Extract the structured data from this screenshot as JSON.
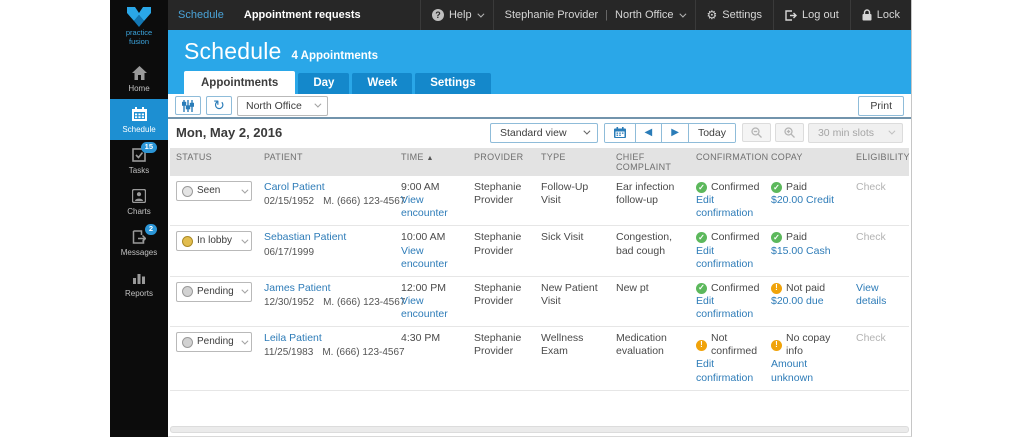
{
  "colors": {
    "accent_blue": "#2aa7e8",
    "tab_blue": "#1488cb",
    "sidebar_active_blue": "#1d8fd2",
    "link_blue": "#2e7cb8",
    "confirmed_green": "#5cb85c",
    "warning_orange": "#f0a30a",
    "topbar_bg": "#272727"
  },
  "sidebar": {
    "logo_line1": "practice",
    "logo_line2": "fusion",
    "items": [
      {
        "label": "Home",
        "icon": "home-icon",
        "active": false,
        "badge": ""
      },
      {
        "label": "Schedule",
        "icon": "calendar-icon",
        "active": true,
        "badge": ""
      },
      {
        "label": "Tasks",
        "icon": "tasks-icon",
        "active": false,
        "badge": "15"
      },
      {
        "label": "Charts",
        "icon": "person-icon",
        "active": false,
        "badge": ""
      },
      {
        "label": "Messages",
        "icon": "message-icon",
        "active": false,
        "badge": "2"
      },
      {
        "label": "Reports",
        "icon": "bar-chart-icon",
        "active": false,
        "badge": ""
      }
    ]
  },
  "topbar": {
    "nav": [
      {
        "label": "Schedule",
        "active": true
      },
      {
        "label": "Appointment requests",
        "active": false
      }
    ],
    "help": "Help",
    "user": "Stephanie Provider",
    "office": "North Office",
    "settings": "Settings",
    "logout": "Log out",
    "lock": "Lock"
  },
  "header": {
    "title": "Schedule",
    "subtitle": "4 Appointments",
    "tabs": [
      {
        "label": "Appointments",
        "active": true
      },
      {
        "label": "Day",
        "active": false
      },
      {
        "label": "Week",
        "active": false
      },
      {
        "label": "Settings",
        "active": false
      }
    ]
  },
  "toolbar": {
    "office_dropdown": "North Office",
    "print_label": "Print"
  },
  "datebar": {
    "date": "Mon, May 2, 2016",
    "view_dropdown": "Standard view",
    "today_label": "Today",
    "slots_dropdown": "30 min slots",
    "prev_glyph": "◀",
    "next_glyph": "▶"
  },
  "table": {
    "columns": [
      "STATUS",
      "PATIENT",
      "TIME",
      "PROVIDER",
      "TYPE",
      "CHIEF COMPLAINT",
      "CONFIRMATION",
      "COPAY",
      "ELIGIBILITY"
    ],
    "sort_indicator": "▲",
    "rows": [
      {
        "status": {
          "label": "Seen",
          "color": "seen"
        },
        "patient": {
          "name": "Carol Patient",
          "dob": "02/15/1952",
          "phone": "M. (666) 123-4567"
        },
        "time": {
          "value": "9:00 AM",
          "link": "View encounter"
        },
        "provider": "Stephanie Provider",
        "type": "Follow-Up Visit",
        "complaint": "Ear infection follow-up",
        "confirmation": {
          "icon": "check",
          "status": "Confirmed",
          "link": "Edit confirmation"
        },
        "copay": {
          "icon": "check",
          "status": "Paid",
          "link": "$20.00 Credit"
        },
        "eligibility": {
          "label": "Check",
          "type": "muted"
        }
      },
      {
        "status": {
          "label": "In lobby",
          "color": "lobby"
        },
        "patient": {
          "name": "Sebastian Patient",
          "dob": "06/17/1999",
          "phone": ""
        },
        "time": {
          "value": "10:00 AM",
          "link": "View encounter"
        },
        "provider": "Stephanie Provider",
        "type": "Sick Visit",
        "complaint": "Congestion, bad cough",
        "confirmation": {
          "icon": "check",
          "status": "Confirmed",
          "link": "Edit confirmation"
        },
        "copay": {
          "icon": "check",
          "status": "Paid",
          "link": "$15.00 Cash"
        },
        "eligibility": {
          "label": "Check",
          "type": "muted"
        }
      },
      {
        "status": {
          "label": "Pending a...",
          "color": "pending"
        },
        "patient": {
          "name": "James Patient",
          "dob": "12/30/1952",
          "phone": "M. (666) 123-4567"
        },
        "time": {
          "value": "12:00 PM",
          "link": "View encounter"
        },
        "provider": "Stephanie Provider",
        "type": "New Patient Visit",
        "complaint": "New pt",
        "confirmation": {
          "icon": "check",
          "status": "Confirmed",
          "link": "Edit confirmation"
        },
        "copay": {
          "icon": "warn",
          "status": "Not paid",
          "link": "$20.00 due"
        },
        "eligibility": {
          "label": "View details",
          "type": "link"
        }
      },
      {
        "status": {
          "label": "Pending a...",
          "color": "pending"
        },
        "patient": {
          "name": "Leila Patient",
          "dob": "11/25/1983",
          "phone": "M. (666) 123-4567"
        },
        "time": {
          "value": "4:30 PM",
          "link": ""
        },
        "provider": "Stephanie Provider",
        "type": "Wellness Exam",
        "complaint": "Medication evaluation",
        "confirmation": {
          "icon": "warn",
          "status": "Not confirmed",
          "link": "Edit confirmation"
        },
        "copay": {
          "icon": "warn",
          "status": "No copay info",
          "link": "Amount unknown"
        },
        "eligibility": {
          "label": "Check",
          "type": "muted"
        }
      }
    ]
  }
}
